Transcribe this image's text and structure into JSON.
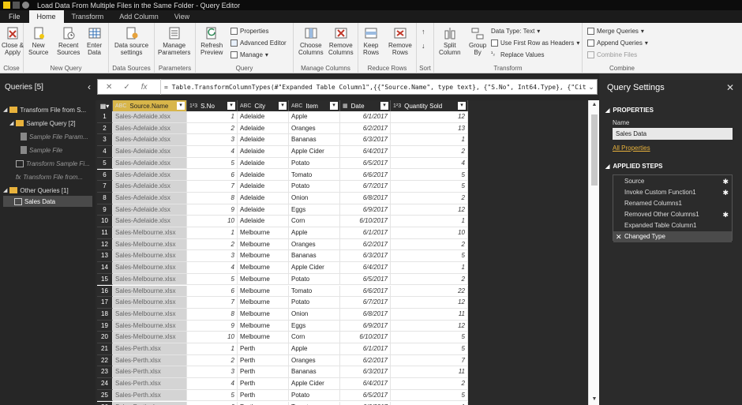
{
  "window": {
    "title": "Load Data From Multiple Files in the Same Folder - Query Editor"
  },
  "tabs": [
    "File",
    "Home",
    "Transform",
    "Add Column",
    "View"
  ],
  "active_tab": "Home",
  "ribbon": {
    "close": {
      "btn": "Close &",
      "btn2": "Apply",
      "label": "Close"
    },
    "new_query": {
      "new_source": "New",
      "new_source2": "Source",
      "recent": "Recent",
      "recent2": "Sources",
      "enter": "Enter",
      "enter2": "Data",
      "label": "New Query"
    },
    "data_sources": {
      "btn": "Data source",
      "btn2": "settings",
      "label": "Data Sources"
    },
    "parameters": {
      "btn": "Manage",
      "btn2": "Parameters",
      "label": "Parameters"
    },
    "query": {
      "refresh": "Refresh",
      "refresh2": "Preview",
      "properties": "Properties",
      "adv_editor": "Advanced Editor",
      "manage": "Manage",
      "label": "Query"
    },
    "manage_columns": {
      "choose": "Choose",
      "choose2": "Columns",
      "remove": "Remove",
      "remove2": "Columns",
      "label": "Manage Columns"
    },
    "reduce_rows": {
      "keep": "Keep",
      "keep2": "Rows",
      "remove": "Remove",
      "remove2": "Rows",
      "label": "Reduce Rows"
    },
    "sort": {
      "label": "Sort"
    },
    "transform": {
      "split": "Split",
      "split2": "Column",
      "group": "Group",
      "group2": "By",
      "data_type": "Data Type: Text",
      "first_row": "Use First Row as Headers",
      "replace": "Replace Values",
      "label": "Transform"
    },
    "combine": {
      "merge": "Merge Queries",
      "append": "Append Queries",
      "combine_files": "Combine Files",
      "label": "Combine"
    }
  },
  "queries": {
    "title": "Queries [5]",
    "items": [
      {
        "label": "Transform File from S...",
        "type": "folder"
      },
      {
        "label": "Sample Query [2]",
        "type": "folder"
      },
      {
        "label": "Sample File Param...",
        "type": "param"
      },
      {
        "label": "Sample File",
        "type": "file"
      },
      {
        "label": "Transform Sample Fi...",
        "type": "table"
      },
      {
        "label": "Transform File from...",
        "type": "function"
      },
      {
        "label": "Other Queries [1]",
        "type": "folder"
      },
      {
        "label": "Sales Data",
        "type": "table"
      }
    ]
  },
  "formula": {
    "fx": "fx",
    "text": "= Table.TransformColumnTypes(#\"Expanded Table Column1\",{{\"Source.Name\", type text}, {\"S.No\", Int64.Type}, {\"City\","
  },
  "columns": [
    {
      "type": "ABC",
      "name": "Source.Name"
    },
    {
      "type": "1²3",
      "name": "S.No"
    },
    {
      "type": "ABC",
      "name": "City"
    },
    {
      "type": "ABC",
      "name": "Item"
    },
    {
      "type": "▦",
      "name": "Date"
    },
    {
      "type": "1²3",
      "name": "Quantity Sold"
    }
  ],
  "rows": [
    [
      "1",
      "Sales-Adelaide.xlsx",
      "1",
      "Adelaide",
      "Apple",
      "6/1/2017",
      "12"
    ],
    [
      "2",
      "Sales-Adelaide.xlsx",
      "2",
      "Adelaide",
      "Oranges",
      "6/2/2017",
      "13"
    ],
    [
      "3",
      "Sales-Adelaide.xlsx",
      "3",
      "Adelaide",
      "Bananas",
      "6/3/2017",
      "1"
    ],
    [
      "4",
      "Sales-Adelaide.xlsx",
      "4",
      "Adelaide",
      "Apple Cider",
      "6/4/2017",
      "2"
    ],
    [
      "5",
      "Sales-Adelaide.xlsx",
      "5",
      "Adelaide",
      "Potato",
      "6/5/2017",
      "4"
    ],
    [
      "6",
      "Sales-Adelaide.xlsx",
      "6",
      "Adelaide",
      "Tomato",
      "6/6/2017",
      "5"
    ],
    [
      "7",
      "Sales-Adelaide.xlsx",
      "7",
      "Adelaide",
      "Potato",
      "6/7/2017",
      "5"
    ],
    [
      "8",
      "Sales-Adelaide.xlsx",
      "8",
      "Adelaide",
      "Onion",
      "6/8/2017",
      "2"
    ],
    [
      "9",
      "Sales-Adelaide.xlsx",
      "9",
      "Adelaide",
      "Eggs",
      "6/9/2017",
      "12"
    ],
    [
      "10",
      "Sales-Adelaide.xlsx",
      "10",
      "Adelaide",
      "Corn",
      "6/10/2017",
      "1"
    ],
    [
      "11",
      "Sales-Melbourne.xlsx",
      "1",
      "Melbourne",
      "Apple",
      "6/1/2017",
      "10"
    ],
    [
      "12",
      "Sales-Melbourne.xlsx",
      "2",
      "Melbourne",
      "Oranges",
      "6/2/2017",
      "2"
    ],
    [
      "13",
      "Sales-Melbourne.xlsx",
      "3",
      "Melbourne",
      "Bananas",
      "6/3/2017",
      "5"
    ],
    [
      "14",
      "Sales-Melbourne.xlsx",
      "4",
      "Melbourne",
      "Apple Cider",
      "6/4/2017",
      "1"
    ],
    [
      "15",
      "Sales-Melbourne.xlsx",
      "5",
      "Melbourne",
      "Potato",
      "6/5/2017",
      "2"
    ],
    [
      "16",
      "Sales-Melbourne.xlsx",
      "6",
      "Melbourne",
      "Tomato",
      "6/6/2017",
      "22"
    ],
    [
      "17",
      "Sales-Melbourne.xlsx",
      "7",
      "Melbourne",
      "Potato",
      "6/7/2017",
      "12"
    ],
    [
      "18",
      "Sales-Melbourne.xlsx",
      "8",
      "Melbourne",
      "Onion",
      "6/8/2017",
      "11"
    ],
    [
      "19",
      "Sales-Melbourne.xlsx",
      "9",
      "Melbourne",
      "Eggs",
      "6/9/2017",
      "12"
    ],
    [
      "20",
      "Sales-Melbourne.xlsx",
      "10",
      "Melbourne",
      "Corn",
      "6/10/2017",
      "5"
    ],
    [
      "21",
      "Sales-Perth.xlsx",
      "1",
      "Perth",
      "Apple",
      "6/1/2017",
      "5"
    ],
    [
      "22",
      "Sales-Perth.xlsx",
      "2",
      "Perth",
      "Oranges",
      "6/2/2017",
      "7"
    ],
    [
      "23",
      "Sales-Perth.xlsx",
      "3",
      "Perth",
      "Bananas",
      "6/3/2017",
      "11"
    ],
    [
      "24",
      "Sales-Perth.xlsx",
      "4",
      "Perth",
      "Apple Cider",
      "6/4/2017",
      "2"
    ],
    [
      "25",
      "Sales-Perth.xlsx",
      "5",
      "Perth",
      "Potato",
      "6/5/2017",
      "5"
    ],
    [
      "26",
      "Sales-Perth.xlsx",
      "6",
      "Perth",
      "Tomato",
      "6/6/2017",
      "1"
    ]
  ],
  "settings": {
    "title": "Query Settings",
    "properties": "PROPERTIES",
    "name_label": "Name",
    "name_value": "Sales Data",
    "all_properties": "All Properties",
    "applied_steps": "APPLIED STEPS",
    "steps": [
      {
        "label": "Source",
        "gear": true
      },
      {
        "label": "Invoke Custom Function1",
        "gear": true
      },
      {
        "label": "Renamed Columns1",
        "gear": false
      },
      {
        "label": "Removed Other Columns1",
        "gear": true
      },
      {
        "label": "Expanded Table Column1",
        "gear": false
      },
      {
        "label": "Changed Type",
        "gear": false
      }
    ],
    "selected_step": "Changed Type"
  },
  "colors": {
    "accent": "#d8b64a",
    "dark": "#2b2b2b"
  }
}
